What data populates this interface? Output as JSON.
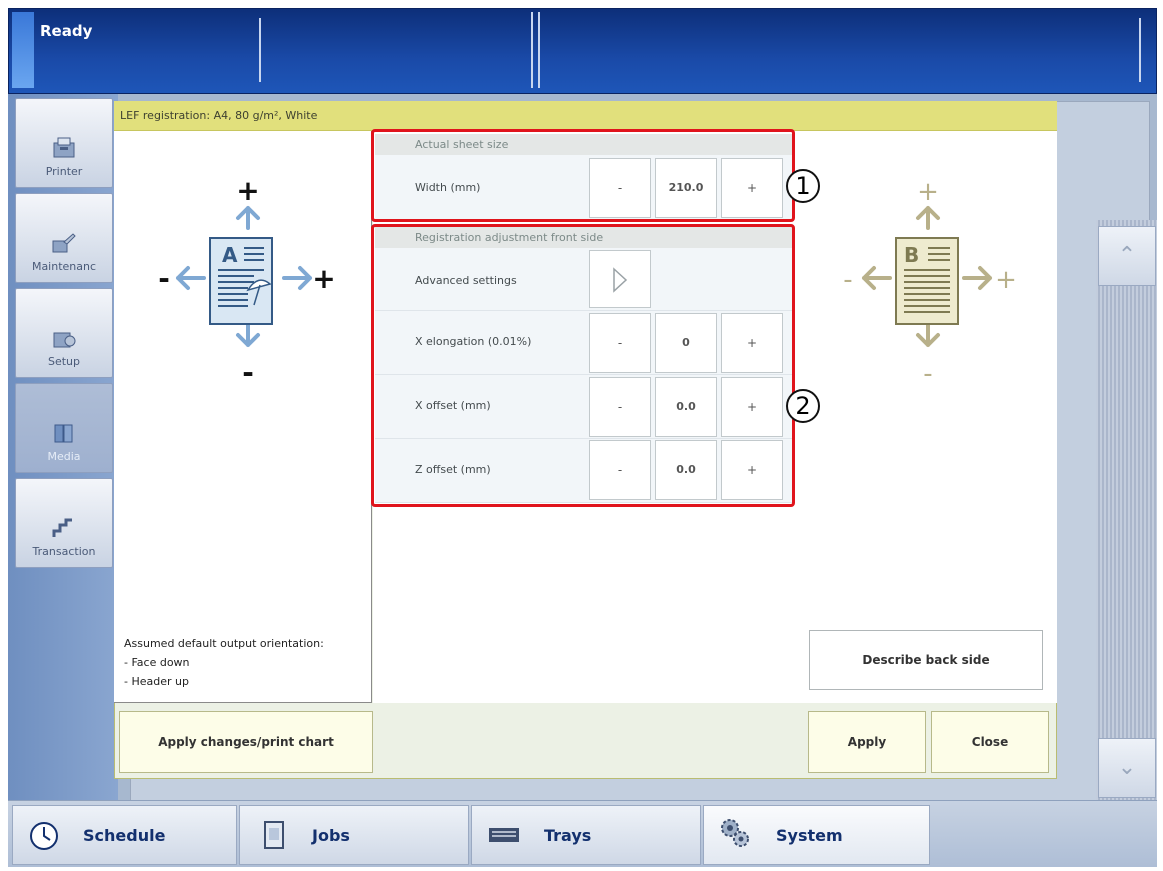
{
  "status": {
    "text": "Ready"
  },
  "nav": [
    {
      "label": "Printer"
    },
    {
      "label": "Maintenanc"
    },
    {
      "label": "Setup"
    },
    {
      "label": "Media"
    },
    {
      "label": "Transaction"
    }
  ],
  "dialog": {
    "title": "LEF registration: A4, 80 g/m², White",
    "actual_sheet_size": {
      "header": "Actual sheet size",
      "width_label": "Width (mm)",
      "width_value": "210.0"
    },
    "registration": {
      "header": "Registration adjustment front side",
      "advanced_label": "Advanced settings",
      "x_elongation_label": "X elongation (0.01%)",
      "x_elongation_value": "0",
      "x_offset_label": "X offset (mm)",
      "x_offset_value": "0.0",
      "z_offset_label": "Z offset (mm)",
      "z_offset_value": "0.0"
    },
    "minus": "-",
    "plus": "+",
    "callouts": [
      "1",
      "2"
    ],
    "front_diagram": {
      "plus": "+",
      "minus": "-",
      "letter": "A"
    },
    "back_diagram": {
      "plus": "+",
      "minus": "-",
      "letter": "B"
    },
    "orientation_note": {
      "line1": "Assumed default output orientation:",
      "line2": "- Face down",
      "line3": "- Header up"
    },
    "describe_back_label": "Describe back side",
    "apply_changes_label": "Apply changes/print chart",
    "apply_label": "Apply",
    "close_label": "Close"
  },
  "tabs": [
    {
      "label": "Schedule"
    },
    {
      "label": "Jobs"
    },
    {
      "label": "Trays"
    },
    {
      "label": "System"
    }
  ],
  "colors": {
    "highlight": "#e0141c",
    "dialog_title": "#e1e07c",
    "front_arrow": "#7fa8d3",
    "back_arrow": "#b8b08a"
  }
}
